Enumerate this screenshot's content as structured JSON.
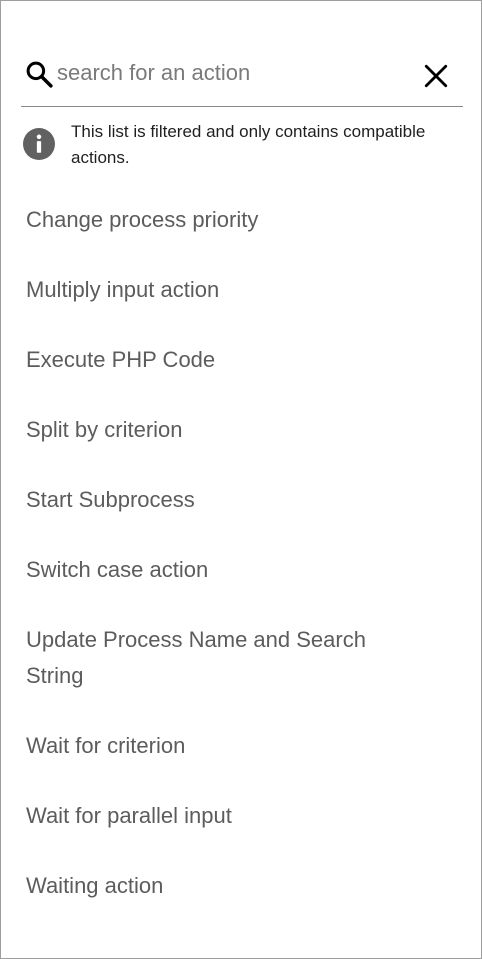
{
  "search": {
    "placeholder": "search for an action",
    "value": ""
  },
  "notice": {
    "text": "This list is filtered and only contains compatible actions."
  },
  "actions": [
    {
      "label": "Change process priority"
    },
    {
      "label": "Multiply input action"
    },
    {
      "label": "Execute PHP Code"
    },
    {
      "label": "Split by criterion"
    },
    {
      "label": "Start Subprocess"
    },
    {
      "label": "Switch case action"
    },
    {
      "label": "Update Process Name and Search String"
    },
    {
      "label": "Wait for criterion"
    },
    {
      "label": "Wait for parallel input"
    },
    {
      "label": "Waiting action"
    }
  ],
  "icons": {
    "search": "search-icon",
    "close": "close-icon",
    "info": "info-icon"
  },
  "colors": {
    "icon": "#000000",
    "info_circle": "#616161",
    "item_text": "#5c5c5c",
    "divider": "#8a8a8a"
  }
}
